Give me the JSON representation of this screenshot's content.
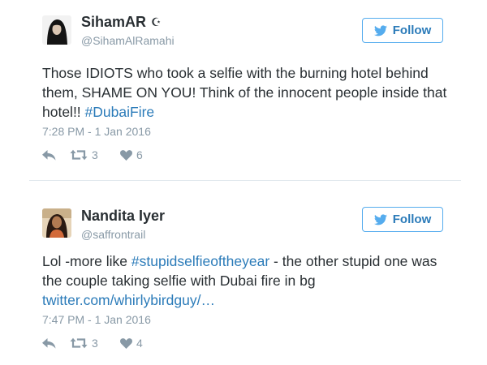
{
  "tweets": [
    {
      "display_name": "SihamAR",
      "verified_glyph": "☪",
      "handle": "@SihamAlRamahi",
      "follow_label": "Follow",
      "text_lines": [
        "Those IDIOTS who took a selfie with the burning hotel behind",
        "them, SHAME ON YOU! Think of the innocent people inside that"
      ],
      "text_line3_prefix": "hotel!! ",
      "hashtag": "#DubaiFire",
      "timestamp": "7:28 PM - 1 Jan 2016",
      "retweets": "3",
      "likes": "6",
      "avatar_icon": "profile-photo"
    },
    {
      "display_name": "Nandita Iyer",
      "handle": "@saffrontrail",
      "follow_label": "Follow",
      "text_line1_prefix": "Lol -more like ",
      "hashtag": "#stupidselfieoftheyear",
      "text_line1_suffix": " - the other stupid one was",
      "text_line2": "the couple taking selfie with Dubai fire in bg",
      "link": "twitter.com/whirlybirdguy/…",
      "timestamp": "7:47 PM - 1 Jan 2016",
      "retweets": "3",
      "likes": "4",
      "avatar_icon": "profile-photo"
    }
  ],
  "colors": {
    "accent": "#55acee",
    "link": "#2b7bb9",
    "muted": "#8899a6",
    "text": "#292f33",
    "divider": "#e1e8ed"
  },
  "icons": {
    "follow": "twitter-bird-icon",
    "reply": "reply-icon",
    "retweet": "retweet-icon",
    "like": "heart-icon"
  }
}
